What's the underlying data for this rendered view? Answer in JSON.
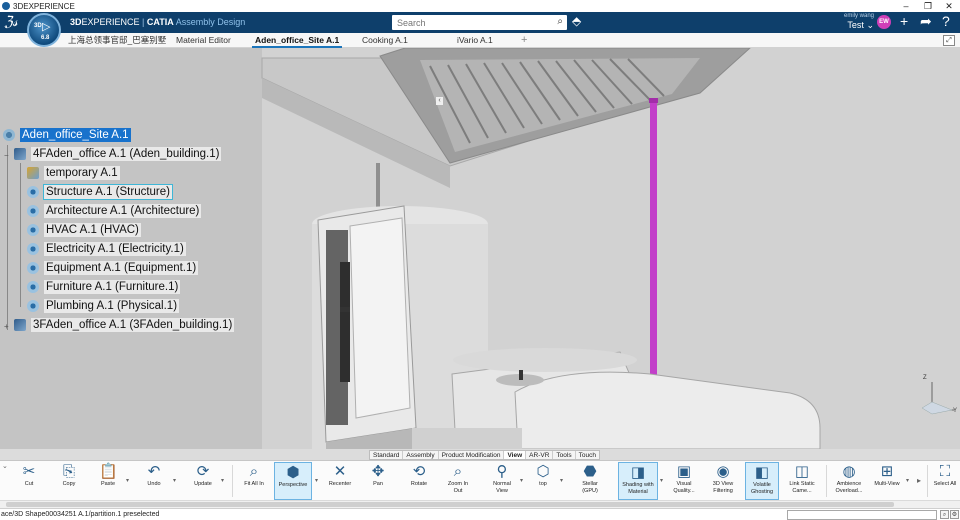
{
  "window": {
    "title": "3DEXPERIENCE"
  },
  "header": {
    "brand_bold": "3D",
    "brand_rest": "EXPERIENCE",
    "separator": " | ",
    "product": "CATIA",
    "module": "Assembly Design",
    "compass_3d": "3D",
    "compass_version": "6.8",
    "search_placeholder": "Search",
    "user_name": "emily wang",
    "user_env": "Test",
    "avatar_initials": "EW"
  },
  "tabs": [
    {
      "label": "上海总领事官邸_巴塞别墅"
    },
    {
      "label": "Material Editor"
    },
    {
      "label": "Aden_office_Site A.1"
    },
    {
      "label": "Cooking A.1"
    },
    {
      "label": "iVario A.1"
    }
  ],
  "tab_plus": "+",
  "tree": [
    {
      "label": "Aden_office_Site A.1",
      "icon": "root-icon",
      "state": "selected"
    },
    {
      "label": "4FAden_office A.1 (Aden_building.1)",
      "icon": "product-icon"
    },
    {
      "label": "temporary A.1",
      "icon": "temporary-icon"
    },
    {
      "label": "Structure A.1 (Structure)",
      "icon": "assembly-icon",
      "state": "preselected"
    },
    {
      "label": "Architecture A.1 (Architecture)",
      "icon": "assembly-icon"
    },
    {
      "label": "HVAC A.1 (HVAC)",
      "icon": "assembly-icon"
    },
    {
      "label": "Electricity A.1 (Electricity.1)",
      "icon": "assembly-icon"
    },
    {
      "label": "Equipment A.1 (Equipment.1)",
      "icon": "assembly-icon"
    },
    {
      "label": "Furniture A.1 (Furniture.1)",
      "icon": "assembly-icon"
    },
    {
      "label": "Plumbing A.1 (Physical.1)",
      "icon": "assembly-icon"
    },
    {
      "label": "3FAden_office A.1 (3FAden_building.1)",
      "icon": "product-icon"
    }
  ],
  "axis": {
    "z": "Z",
    "y": "Y"
  },
  "section_tabs": [
    "Standard",
    "Assembly",
    "Product Modification",
    "View",
    "AR-VR",
    "Tools",
    "Touch"
  ],
  "active_section": "View",
  "toolbar": {
    "cut": "Cut",
    "copy": "Copy",
    "paste": "Paste",
    "undo": "Undo",
    "update": "Update",
    "fit_all_in": "Fit All In",
    "perspective": "Perspective",
    "recenter": "Recenter",
    "pan": "Pan",
    "rotate": "Rotate",
    "zoom": "Zoom In Out",
    "normal_view": "Normal View",
    "top": "top",
    "stellar": "Stellar (GPU)",
    "shading_material": "Shading with Material",
    "visual_quality": "Visual Quality...",
    "view_filtering": "3D View Filtering",
    "volatile_ghosting": "Volatile Ghosting",
    "link_camera": "Link Static Came...",
    "ambience": "Ambience Overload...",
    "multi_view": "Multi-View",
    "select_all": "Select All"
  },
  "status": {
    "text": "ace/3D Shape00034251 A.1/partition.1 preselected"
  },
  "colors": {
    "header": "#0e3f6b",
    "selection": "#1872cc",
    "pipe": "#c23fc9",
    "accent": "#1b75bb"
  }
}
